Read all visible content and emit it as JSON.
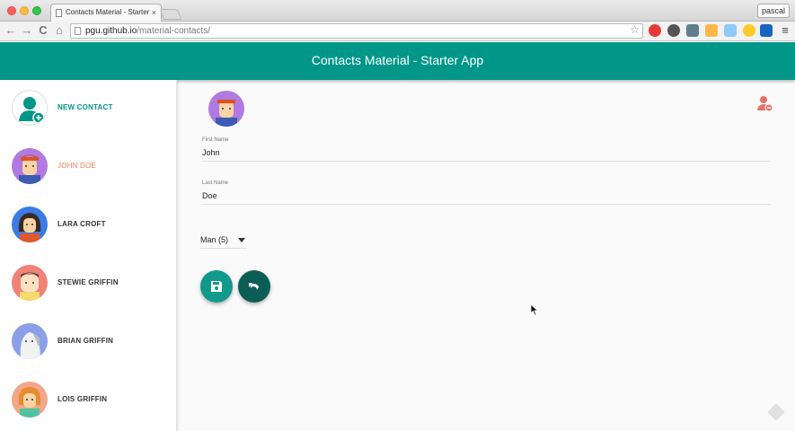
{
  "browser": {
    "tab_title": "Contacts Material - Starter",
    "tab_close": "×",
    "profile_name": "pascal",
    "url_host": "pgu.github.io",
    "url_path": "/material-contacts/",
    "back": "←",
    "forward": "→",
    "reload": "C",
    "home": "⌂",
    "star": "☆",
    "menu": "≡"
  },
  "app": {
    "title": "Contacts Material - Starter App",
    "accent": "#009688",
    "selected_color": "#ef7b55"
  },
  "sidebar": {
    "items": [
      {
        "label": "NEW CONTACT"
      },
      {
        "label": "JOHN DOE"
      },
      {
        "label": "LARA CROFT"
      },
      {
        "label": "STEWIE GRIFFIN"
      },
      {
        "label": "BRIAN GRIFFIN"
      },
      {
        "label": "LOIS GRIFFIN"
      }
    ]
  },
  "form": {
    "first_name_label": "First Name",
    "first_name_value": "John",
    "last_name_label": "Last Name",
    "last_name_value": "Doe",
    "gender_select_value": "Man (5)"
  },
  "icons": {
    "delete": "remove-contact-icon",
    "save": "save-icon",
    "undo": "undo-icon"
  }
}
